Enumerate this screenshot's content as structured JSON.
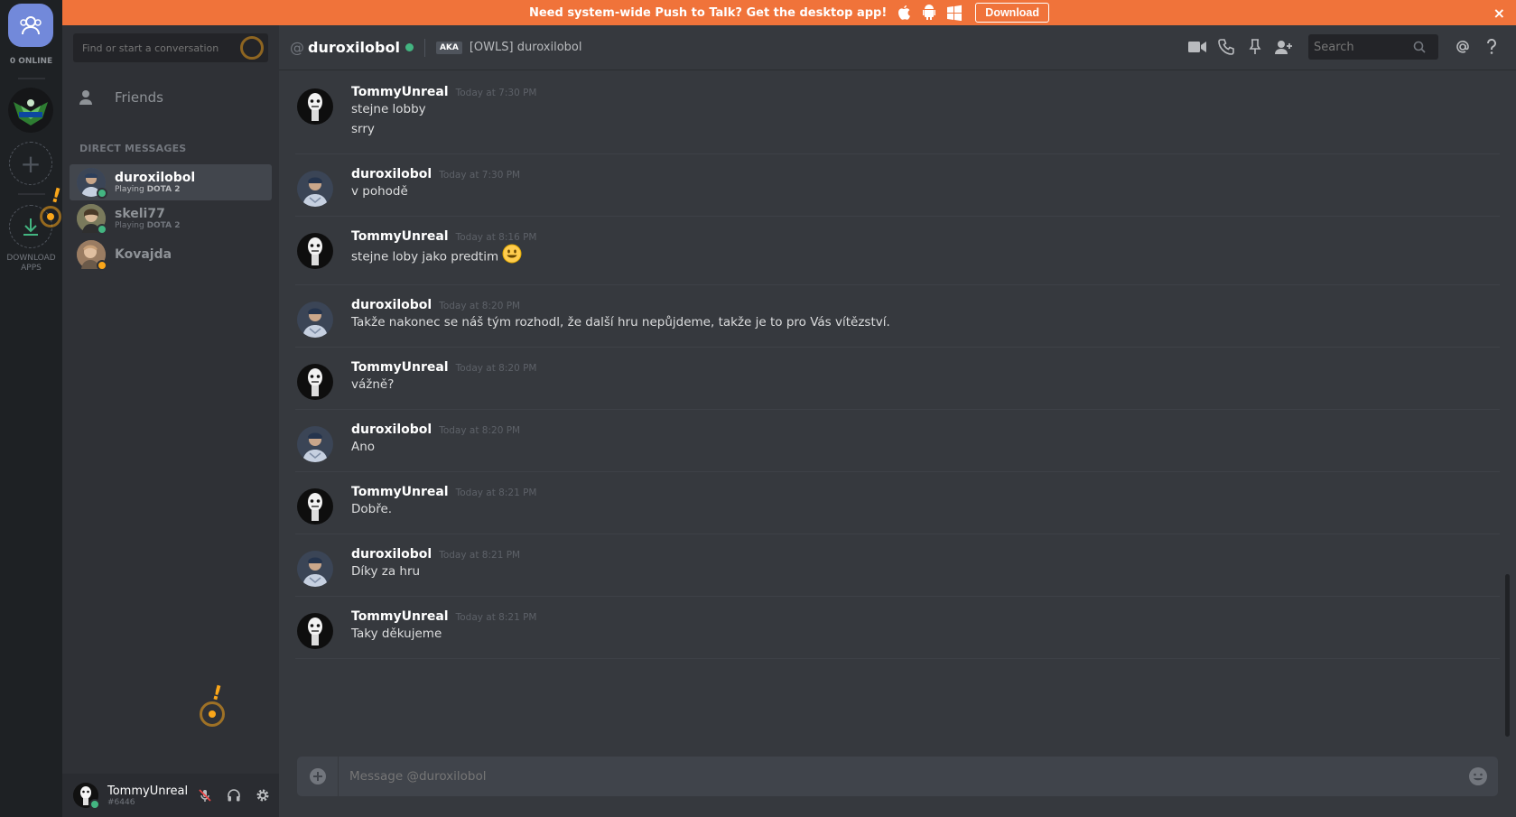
{
  "banner": {
    "text": "Need system-wide Push to Talk? Get the desktop app!",
    "download_label": "Download",
    "close_label": "×"
  },
  "guilds": {
    "online_label": "0 ONLINE",
    "add_label": "+",
    "download_apps_label": "DOWNLOAD APPS"
  },
  "sidebar": {
    "search_placeholder": "Find or start a conversation",
    "friends_label": "Friends",
    "dm_header": "DIRECT MESSAGES",
    "dms": [
      {
        "name": "duroxilobol",
        "activity_prefix": "Playing",
        "activity_game": "DOTA 2",
        "status_color": "#43b581",
        "active": true
      },
      {
        "name": "skeli77",
        "activity_prefix": "Playing",
        "activity_game": "DOTA 2",
        "status_color": "#43b581",
        "active": false
      },
      {
        "name": "Kovajda",
        "activity_prefix": "",
        "activity_game": "",
        "status_color": "#faa61a",
        "active": false
      }
    ]
  },
  "user_panel": {
    "username": "TommyUnreal",
    "tag": "#6446"
  },
  "header": {
    "at": "@",
    "name": "duroxilobol",
    "aka_badge": "AKA",
    "aka_name": "[OWLS] duroxilobol",
    "search_placeholder": "Search"
  },
  "messages": [
    {
      "author": "TommyUnreal",
      "time": "Today at 7:30 PM",
      "lines": [
        "stejne lobby",
        "srry"
      ],
      "avatar": "tommy"
    },
    {
      "author": "duroxilobol",
      "time": "Today at 7:30 PM",
      "lines": [
        "v pohodě"
      ],
      "avatar": "durox"
    },
    {
      "author": "TommyUnreal",
      "time": "Today at 8:16 PM",
      "lines": [
        "stejne loby jako predtim"
      ],
      "avatar": "tommy",
      "emoji": "smiley-emoji"
    },
    {
      "author": "duroxilobol",
      "time": "Today at 8:20 PM",
      "lines": [
        "Takže nakonec se náš tým rozhodl, že další hru nepůjdeme, takže je to pro Vás vítězství."
      ],
      "avatar": "durox"
    },
    {
      "author": "TommyUnreal",
      "time": "Today at 8:20 PM",
      "lines": [
        "vážně?"
      ],
      "avatar": "tommy"
    },
    {
      "author": "duroxilobol",
      "time": "Today at 8:20 PM",
      "lines": [
        "Ano"
      ],
      "avatar": "durox"
    },
    {
      "author": "TommyUnreal",
      "time": "Today at 8:21 PM",
      "lines": [
        "Dobře."
      ],
      "avatar": "tommy"
    },
    {
      "author": "duroxilobol",
      "time": "Today at 8:21 PM",
      "lines": [
        "Díky za hru"
      ],
      "avatar": "durox"
    },
    {
      "author": "TommyUnreal",
      "time": "Today at 8:21 PM",
      "lines": [
        "Taky děkujeme"
      ],
      "avatar": "tommy"
    }
  ],
  "composer": {
    "placeholder": "Message @duroxilobol"
  },
  "colors": {
    "banner": "#f0733a",
    "blurple": "#7289da",
    "online": "#43b581",
    "idle": "#faa61a"
  }
}
